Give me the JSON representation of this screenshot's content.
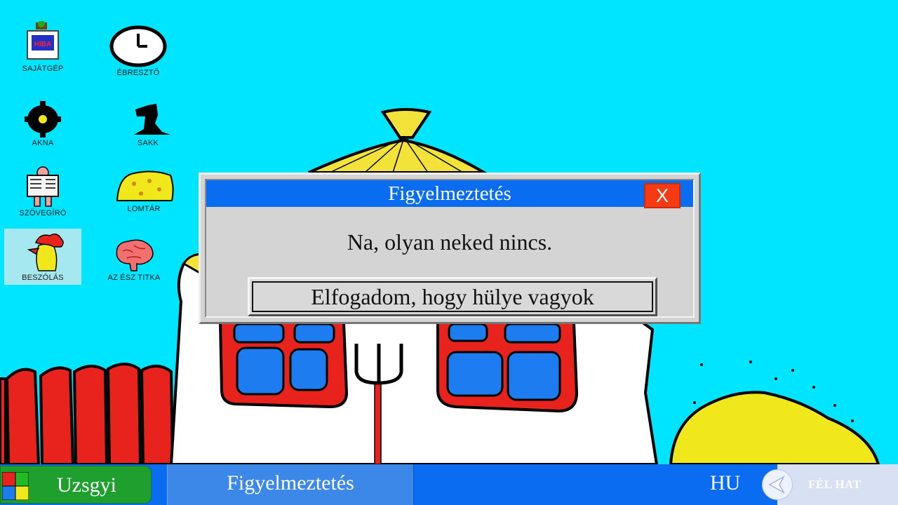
{
  "desktop": {
    "icons": [
      {
        "label": "SAJÁTGÉP",
        "badge": "HIBA"
      },
      {
        "label": "ÉBRESZTŐ"
      },
      {
        "label": "AKNA"
      },
      {
        "label": "SAKK"
      },
      {
        "label": "SZÖVEGÍRÓ"
      },
      {
        "label": "LOMTÁR"
      },
      {
        "label": "BESZÓLÁS"
      },
      {
        "label": "AZ ÉSZ TITKA"
      }
    ]
  },
  "dialog": {
    "title": "Figyelmeztetés",
    "close_label": "X",
    "message": "Na, olyan neked nincs.",
    "accept_label": "Elfogadom, hogy hülye vagyok"
  },
  "taskbar": {
    "start_label": "Uzsgyi",
    "window_label": "Figyelmeztetés",
    "language": "HU",
    "tray_label": "FÉL HAT"
  },
  "colors": {
    "sky": "#00e5ff",
    "taskbar": "#0a6cf0",
    "start_button": "#1fa02e",
    "close_button": "#f43b14",
    "dialog_face": "#d4d4d4"
  }
}
